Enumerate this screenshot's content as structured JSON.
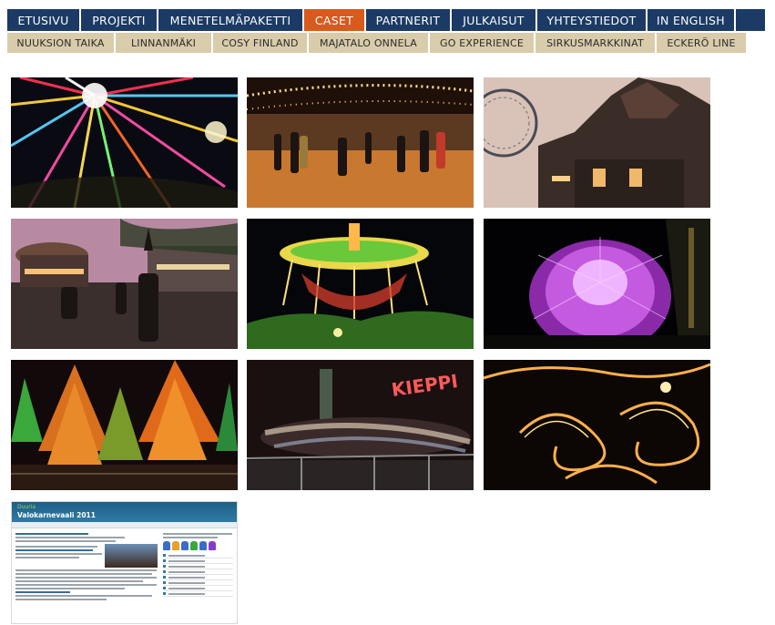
{
  "nav_primary": [
    {
      "label": "ETUSIVU",
      "active": false
    },
    {
      "label": "PROJEKTI",
      "active": false
    },
    {
      "label": "MENETELMÄPAKETTI",
      "active": false
    },
    {
      "label": "CASET",
      "active": true
    },
    {
      "label": "PARTNERIT",
      "active": false
    },
    {
      "label": "JULKAISUT",
      "active": false
    },
    {
      "label": "YHTEYSTIEDOT",
      "active": false
    },
    {
      "label": "IN ENGLISH",
      "active": false
    }
  ],
  "nav_secondary": [
    {
      "label": "NUUKSION TAIKA"
    },
    {
      "label": "LINNANMÄKI"
    },
    {
      "label": "COSY FINLAND"
    },
    {
      "label": "MAJATALO ONNELA"
    },
    {
      "label": "GO EXPERIENCE"
    },
    {
      "label": "SIRKUSMARKKINAT"
    },
    {
      "label": "ECKERÖ LINE"
    }
  ],
  "colors": {
    "nav_primary_bg": "#1b3a66",
    "nav_primary_active": "#d85a1c",
    "nav_secondary_bg": "#d9ccab"
  },
  "gallery": {
    "thumbnails": [
      {
        "subject": "ferris-wheel-lights-icon"
      },
      {
        "subject": "ice-skaters-icon"
      },
      {
        "subject": "amusement-building-icon"
      },
      {
        "subject": "carousel-performers-icon"
      },
      {
        "subject": "swing-carousel-icon"
      },
      {
        "subject": "purple-light-dome-icon"
      },
      {
        "subject": "lit-trees-icon"
      },
      {
        "subject": "kieppi-ride-icon"
      },
      {
        "subject": "fire-swirls-icon"
      }
    ],
    "document_preview": {
      "site_label": "Duuria",
      "title": "Valokarnevaali 2011"
    }
  }
}
